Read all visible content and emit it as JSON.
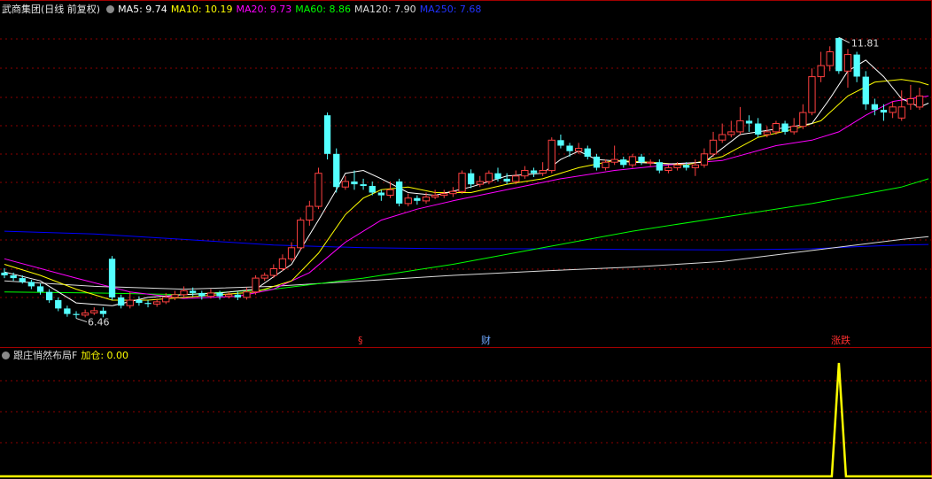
{
  "header": {
    "title": "武商集团(日线 前复权)",
    "ma": [
      {
        "label": "MA5: 9.74",
        "color": "#ffffff"
      },
      {
        "label": "MA10: 10.19",
        "color": "#ffff00"
      },
      {
        "label": "MA20: 9.73",
        "color": "#ff00ff"
      },
      {
        "label": "MA60: 8.86",
        "color": "#00ff00"
      },
      {
        "label": "MA120: 7.90",
        "color": "#dcdcdc"
      },
      {
        "label": "MA250: 7.68",
        "color": "#0000ff"
      }
    ]
  },
  "indicator": {
    "title": "跟庄悄然布局F",
    "value_label": "加仓: 0.00"
  },
  "markers": {
    "s": "§",
    "cai": "财",
    "zhangdie": "涨跌"
  },
  "chart_data": {
    "type": "candlestick",
    "title": "武商集团(日线 前复权)",
    "annotations": {
      "high": "11.81",
      "low": "6.46"
    },
    "ylim": [
      6.2,
      12.2
    ],
    "colors": {
      "up": "#ff4040",
      "down": "#54ffff"
    },
    "candles": [
      [
        7.55,
        7.5,
        7.63,
        7.45
      ],
      [
        7.5,
        7.45,
        7.55,
        7.4
      ],
      [
        7.45,
        7.38,
        7.5,
        7.35
      ],
      [
        7.38,
        7.3,
        7.42,
        7.25
      ],
      [
        7.3,
        7.2,
        7.35,
        7.15
      ],
      [
        7.2,
        7.05,
        7.25,
        7.0
      ],
      [
        7.05,
        6.9,
        7.1,
        6.85
      ],
      [
        6.9,
        6.8,
        6.95,
        6.75
      ],
      [
        6.8,
        6.78,
        6.85,
        6.72
      ],
      [
        6.78,
        6.82,
        6.88,
        6.74
      ],
      [
        6.82,
        6.86,
        6.92,
        6.78
      ],
      [
        6.86,
        6.8,
        6.92,
        6.74
      ],
      [
        7.8,
        7.1,
        7.85,
        7.05
      ],
      [
        7.1,
        6.95,
        7.15,
        6.9
      ],
      [
        6.95,
        7.05,
        7.2,
        6.9
      ],
      [
        7.05,
        7.0,
        7.12,
        6.95
      ],
      [
        7.0,
        6.98,
        7.05,
        6.92
      ],
      [
        6.98,
        7.02,
        7.08,
        6.93
      ],
      [
        7.02,
        7.1,
        7.18,
        6.98
      ],
      [
        7.1,
        7.15,
        7.22,
        7.05
      ],
      [
        7.15,
        7.22,
        7.3,
        7.1
      ],
      [
        7.22,
        7.18,
        7.28,
        7.12
      ],
      [
        7.18,
        7.12,
        7.22,
        7.06
      ],
      [
        7.12,
        7.18,
        7.25,
        7.08
      ],
      [
        7.18,
        7.12,
        7.22,
        7.06
      ],
      [
        7.12,
        7.15,
        7.2,
        7.08
      ],
      [
        7.15,
        7.1,
        7.2,
        7.05
      ],
      [
        7.1,
        7.2,
        7.28,
        7.06
      ],
      [
        7.2,
        7.45,
        7.5,
        7.15
      ],
      [
        7.45,
        7.5,
        7.55,
        7.4
      ],
      [
        7.5,
        7.62,
        7.7,
        7.45
      ],
      [
        7.62,
        7.8,
        7.88,
        7.58
      ],
      [
        7.8,
        8.0,
        8.1,
        7.75
      ],
      [
        8.0,
        8.5,
        8.55,
        7.95
      ],
      [
        8.5,
        8.75,
        8.85,
        8.4
      ],
      [
        8.75,
        9.35,
        9.45,
        8.7
      ],
      [
        10.4,
        9.7,
        10.45,
        9.6
      ],
      [
        9.7,
        9.1,
        9.8,
        9.0
      ],
      [
        9.1,
        9.2,
        9.3,
        9.05
      ],
      [
        9.2,
        9.15,
        9.4,
        9.05
      ],
      [
        9.15,
        9.12,
        9.25,
        9.05
      ],
      [
        9.12,
        9.0,
        9.2,
        8.95
      ],
      [
        9.0,
        8.95,
        9.05,
        8.85
      ],
      [
        8.95,
        9.05,
        9.2,
        8.9
      ],
      [
        9.2,
        8.8,
        9.25,
        8.75
      ],
      [
        8.8,
        8.9,
        8.98,
        8.75
      ],
      [
        8.9,
        8.85,
        8.95,
        8.78
      ],
      [
        8.85,
        8.92,
        9.0,
        8.8
      ],
      [
        8.92,
        8.95,
        9.05,
        8.88
      ],
      [
        8.95,
        8.98,
        9.05,
        8.9
      ],
      [
        8.98,
        9.02,
        9.1,
        8.92
      ],
      [
        9.02,
        9.35,
        9.4,
        8.98
      ],
      [
        9.35,
        9.15,
        9.42,
        9.08
      ],
      [
        9.15,
        9.2,
        9.3,
        9.1
      ],
      [
        9.2,
        9.35,
        9.4,
        9.15
      ],
      [
        9.35,
        9.25,
        9.45,
        9.2
      ],
      [
        9.25,
        9.2,
        9.35,
        9.15
      ],
      [
        9.2,
        9.3,
        9.4,
        9.15
      ],
      [
        9.3,
        9.4,
        9.48,
        9.25
      ],
      [
        9.4,
        9.35,
        9.45,
        9.28
      ],
      [
        9.35,
        9.4,
        9.55,
        9.3
      ],
      [
        9.4,
        9.95,
        10.0,
        9.35
      ],
      [
        9.95,
        9.85,
        10.05,
        9.8
      ],
      [
        9.85,
        9.75,
        9.9,
        9.65
      ],
      [
        9.75,
        9.8,
        9.9,
        9.7
      ],
      [
        9.8,
        9.65,
        9.85,
        9.6
      ],
      [
        9.65,
        9.45,
        9.7,
        9.4
      ],
      [
        9.45,
        9.55,
        9.6,
        9.4
      ],
      [
        9.55,
        9.6,
        9.85,
        9.5
      ],
      [
        9.6,
        9.5,
        9.65,
        9.45
      ],
      [
        9.5,
        9.65,
        9.7,
        9.45
      ],
      [
        9.65,
        9.55,
        9.7,
        9.5
      ],
      [
        9.55,
        9.55,
        9.6,
        9.48
      ],
      [
        9.55,
        9.4,
        9.6,
        9.35
      ],
      [
        9.4,
        9.45,
        9.5,
        9.35
      ],
      [
        9.45,
        9.5,
        9.55,
        9.4
      ],
      [
        9.5,
        9.45,
        9.55,
        9.4
      ],
      [
        9.45,
        9.5,
        9.6,
        9.3
      ],
      [
        9.5,
        9.7,
        9.8,
        9.45
      ],
      [
        9.7,
        9.95,
        10.1,
        9.65
      ],
      [
        9.95,
        10.05,
        10.25,
        9.9
      ],
      [
        10.05,
        10.1,
        10.3,
        10.0
      ],
      [
        10.1,
        10.3,
        10.55,
        10.05
      ],
      [
        10.3,
        10.25,
        10.4,
        10.1
      ],
      [
        10.25,
        10.05,
        10.35,
        10.0
      ],
      [
        10.05,
        10.1,
        10.2,
        10.0
      ],
      [
        10.1,
        10.25,
        10.3,
        10.05
      ],
      [
        10.25,
        10.1,
        10.3,
        10.05
      ],
      [
        10.1,
        10.2,
        10.35,
        10.05
      ],
      [
        10.2,
        10.45,
        10.6,
        10.15
      ],
      [
        10.45,
        11.1,
        11.25,
        10.4
      ],
      [
        11.1,
        11.3,
        11.55,
        11.0
      ],
      [
        11.3,
        11.55,
        11.65,
        11.2
      ],
      [
        11.8,
        11.2,
        11.81,
        11.15
      ],
      [
        11.2,
        11.5,
        11.6,
        10.9
      ],
      [
        11.5,
        11.1,
        11.55,
        11.0
      ],
      [
        11.1,
        10.6,
        11.2,
        10.5
      ],
      [
        10.6,
        10.5,
        10.7,
        10.4
      ],
      [
        10.5,
        10.45,
        10.6,
        10.3
      ],
      [
        10.45,
        10.55,
        10.65,
        10.35
      ],
      [
        10.35,
        10.55,
        10.85,
        10.3
      ],
      [
        10.6,
        10.7,
        10.95,
        10.5
      ],
      [
        10.55,
        10.75,
        10.9,
        10.5
      ]
    ],
    "ma_series": [
      {
        "name": "MA5",
        "values": [
          [
            0,
            7.56
          ],
          [
            4,
            7.4
          ],
          [
            8,
            7.0
          ],
          [
            12,
            6.95
          ],
          [
            16,
            7.1
          ],
          [
            20,
            7.15
          ],
          [
            24,
            7.18
          ],
          [
            28,
            7.25
          ],
          [
            32,
            7.7
          ],
          [
            35,
            8.5
          ],
          [
            37,
            9.05
          ],
          [
            38,
            9.35
          ],
          [
            40,
            9.4
          ],
          [
            42,
            9.25
          ],
          [
            45,
            9.0
          ],
          [
            48,
            8.95
          ],
          [
            52,
            9.1
          ],
          [
            56,
            9.3
          ],
          [
            60,
            9.35
          ],
          [
            62,
            9.6
          ],
          [
            64,
            9.75
          ],
          [
            66,
            9.6
          ],
          [
            70,
            9.55
          ],
          [
            74,
            9.52
          ],
          [
            78,
            9.55
          ],
          [
            82,
            10.05
          ],
          [
            86,
            10.15
          ],
          [
            90,
            10.25
          ],
          [
            92,
            10.7
          ],
          [
            94,
            11.2
          ],
          [
            96,
            11.4
          ],
          [
            98,
            11.1
          ],
          [
            100,
            10.7
          ],
          [
            102,
            10.55
          ],
          [
            103,
            10.62
          ]
        ]
      },
      {
        "name": "MA10",
        "values": [
          [
            0,
            7.7
          ],
          [
            4,
            7.5
          ],
          [
            8,
            7.25
          ],
          [
            12,
            7.05
          ],
          [
            16,
            7.05
          ],
          [
            20,
            7.1
          ],
          [
            24,
            7.15
          ],
          [
            28,
            7.2
          ],
          [
            32,
            7.4
          ],
          [
            35,
            7.9
          ],
          [
            38,
            8.6
          ],
          [
            40,
            8.9
          ],
          [
            42,
            9.05
          ],
          [
            45,
            9.1
          ],
          [
            48,
            9.0
          ],
          [
            52,
            9.0
          ],
          [
            56,
            9.15
          ],
          [
            60,
            9.25
          ],
          [
            64,
            9.45
          ],
          [
            68,
            9.58
          ],
          [
            72,
            9.55
          ],
          [
            76,
            9.5
          ],
          [
            80,
            9.65
          ],
          [
            84,
            10.0
          ],
          [
            88,
            10.15
          ],
          [
            91,
            10.3
          ],
          [
            94,
            10.75
          ],
          [
            97,
            11.0
          ],
          [
            100,
            11.05
          ],
          [
            102,
            11.0
          ],
          [
            103,
            10.95
          ]
        ]
      },
      {
        "name": "MA20",
        "values": [
          [
            0,
            7.8
          ],
          [
            8,
            7.45
          ],
          [
            14,
            7.2
          ],
          [
            20,
            7.08
          ],
          [
            26,
            7.12
          ],
          [
            30,
            7.25
          ],
          [
            34,
            7.55
          ],
          [
            38,
            8.1
          ],
          [
            42,
            8.5
          ],
          [
            46,
            8.7
          ],
          [
            50,
            8.85
          ],
          [
            56,
            9.05
          ],
          [
            62,
            9.25
          ],
          [
            68,
            9.4
          ],
          [
            74,
            9.5
          ],
          [
            80,
            9.58
          ],
          [
            86,
            9.85
          ],
          [
            90,
            9.95
          ],
          [
            93,
            10.1
          ],
          [
            96,
            10.4
          ],
          [
            99,
            10.65
          ],
          [
            101,
            10.7
          ],
          [
            103,
            10.75
          ]
        ]
      },
      {
        "name": "MA60",
        "values": [
          [
            0,
            7.2
          ],
          [
            10,
            7.18
          ],
          [
            20,
            7.15
          ],
          [
            30,
            7.25
          ],
          [
            40,
            7.45
          ],
          [
            50,
            7.7
          ],
          [
            60,
            8.0
          ],
          [
            70,
            8.3
          ],
          [
            80,
            8.55
          ],
          [
            90,
            8.8
          ],
          [
            100,
            9.1
          ],
          [
            103,
            9.25
          ]
        ]
      },
      {
        "name": "MA120",
        "values": [
          [
            0,
            7.4
          ],
          [
            10,
            7.3
          ],
          [
            20,
            7.25
          ],
          [
            30,
            7.3
          ],
          [
            40,
            7.4
          ],
          [
            50,
            7.5
          ],
          [
            60,
            7.58
          ],
          [
            70,
            7.65
          ],
          [
            80,
            7.75
          ],
          [
            90,
            7.95
          ],
          [
            100,
            8.15
          ],
          [
            103,
            8.2
          ]
        ]
      },
      {
        "name": "MA250",
        "values": [
          [
            0,
            8.3
          ],
          [
            10,
            8.25
          ],
          [
            20,
            8.15
          ],
          [
            30,
            8.05
          ],
          [
            40,
            8.0
          ],
          [
            50,
            7.98
          ],
          [
            60,
            7.98
          ],
          [
            70,
            7.97
          ],
          [
            80,
            7.96
          ],
          [
            90,
            7.98
          ],
          [
            95,
            8.02
          ],
          [
            100,
            8.05
          ],
          [
            103,
            8.06
          ]
        ]
      }
    ],
    "indicator": {
      "name": "加仓",
      "spike_index": 93,
      "spike_value": 1,
      "value": 0
    }
  }
}
